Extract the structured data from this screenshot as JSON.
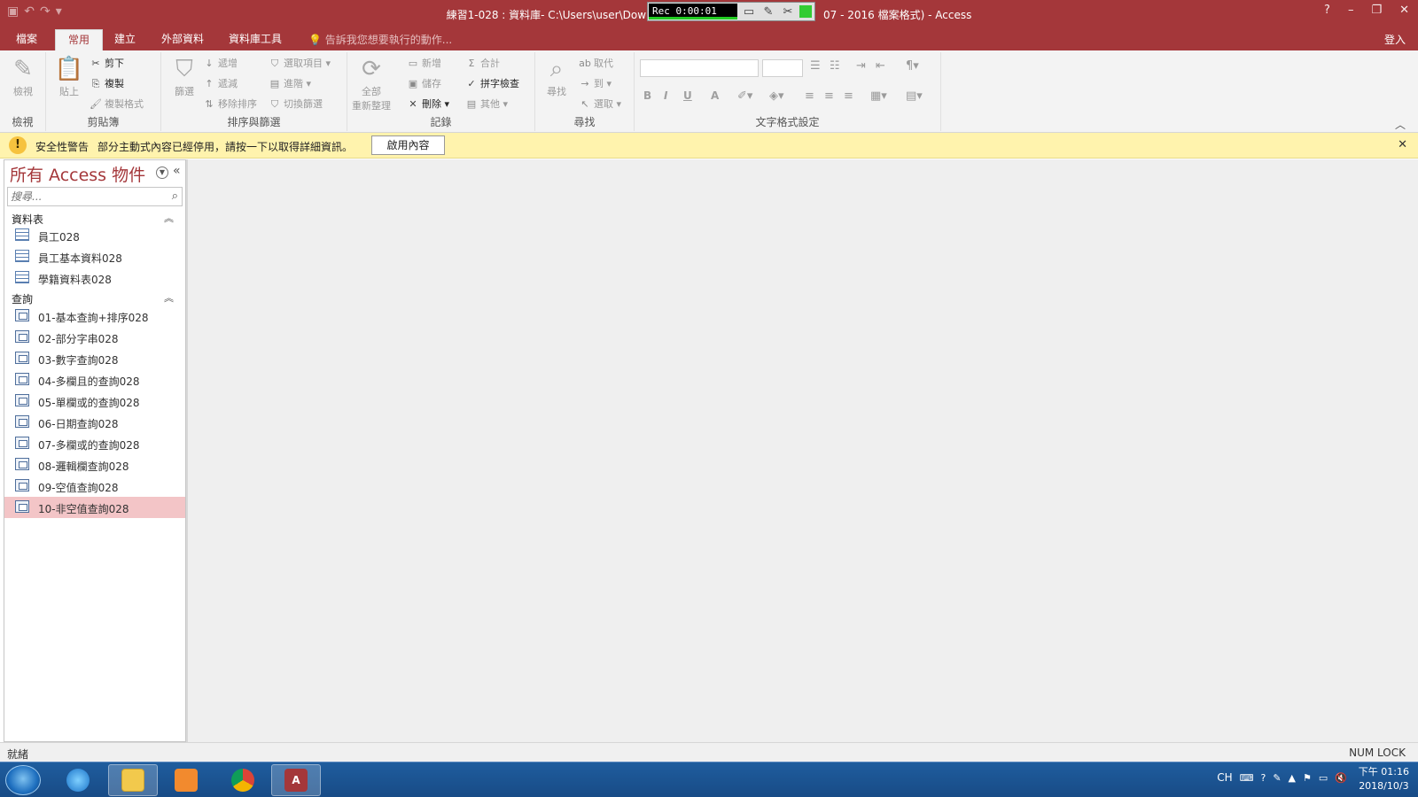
{
  "title_bar": {
    "title": "練習1-028 : 資料庫- C:\\Users\\user\\Dow",
    "title_suffix": "07 - 2016 檔案格式) - Access",
    "recorder_time": "Rec 0:00:01",
    "help": "?",
    "minimize": "–",
    "restore": "❐",
    "close": "✕"
  },
  "tabs": [
    {
      "label": "檔案"
    },
    {
      "label": "常用"
    },
    {
      "label": "建立"
    },
    {
      "label": "外部資料"
    },
    {
      "label": "資料庫工具"
    }
  ],
  "tell_me": "告訴我您想要執行的動作...",
  "sign_in": "登入",
  "ribbon": {
    "view": {
      "label": "檢視",
      "group": "檢視"
    },
    "clipboard": {
      "paste": "貼上",
      "cut": "剪下",
      "copy": "複製",
      "format_painter": "複製格式",
      "group": "剪貼簿"
    },
    "sort_filter": {
      "filter": "篩選",
      "ascending": "遞增",
      "descending": "遞減",
      "remove_sort": "移除排序",
      "selection": "選取項目",
      "advanced": "進階",
      "toggle_filter": "切換篩選",
      "group": "排序與篩選"
    },
    "records": {
      "refresh_line1": "全部",
      "refresh_line2": "重新整理",
      "new": "新增",
      "save": "儲存",
      "delete": "刪除",
      "totals": "合計",
      "spelling": "拼字檢查",
      "more": "其他",
      "group": "記錄"
    },
    "find": {
      "find": "尋找",
      "replace": "取代",
      "goto": "到",
      "select": "選取",
      "group": "尋找"
    },
    "text_format": {
      "group": "文字格式設定",
      "bold": "B",
      "italic": "I",
      "underline": "U",
      "font_color": "A"
    }
  },
  "security": {
    "title": "安全性警告",
    "message": "部分主動式內容已經停用，請按一下以取得詳細資訊。",
    "button": "啟用內容",
    "close": "✕"
  },
  "nav": {
    "title": "所有 Access 物件",
    "search_placeholder": "搜尋...",
    "sections": [
      {
        "title": "資料表",
        "items": [
          "員工028",
          "員工基本資料028",
          "學籍資料表028"
        ]
      },
      {
        "title": "查詢",
        "items": [
          "01-基本查詢+排序028",
          "02-部分字串028",
          "03-數字查詢028",
          "04-多欄且的查詢028",
          "05-單欄或的查詢028",
          "06-日期查詢028",
          "07-多欄或的查詢028",
          "08-邏輯欄查詢028",
          "09-空值查詢028",
          "10-非空值查詢028"
        ]
      }
    ],
    "selected": "10-非空值查詢028"
  },
  "status": {
    "left": "就緒",
    "right": "NUM LOCK"
  },
  "taskbar": {
    "lang": "CH",
    "time": "下午 01:16",
    "date": "2018/10/3"
  },
  "colors": {
    "accent": "#a4373a",
    "selected": "#f3c5c7",
    "warning": "#fff3ad"
  }
}
